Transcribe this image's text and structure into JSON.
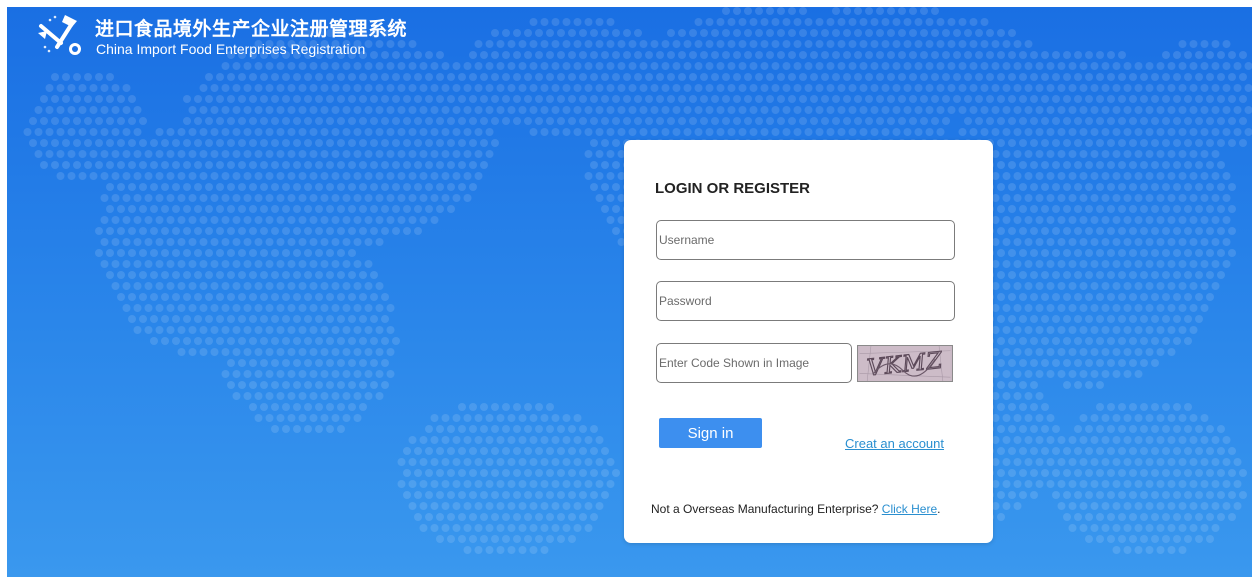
{
  "header": {
    "title_cn": "进口食品境外生产企业注册管理系统",
    "title_en": "China Import Food Enterprises Registration",
    "logo_icon": "crossed-tools-logo-icon"
  },
  "login": {
    "heading": "LOGIN OR REGISTER",
    "username": {
      "placeholder": "Username",
      "value": ""
    },
    "password": {
      "placeholder": "Password",
      "value": ""
    },
    "captcha": {
      "placeholder": "Enter Code Shown in Image",
      "value": "",
      "image_text": "VKMZ"
    },
    "signin_label": "Sign in",
    "create_account_label": "Creat an account",
    "footer_text": "Not a Overseas Manufacturing Enterprise? ",
    "footer_link_label": "Click Here",
    "footer_end": "."
  },
  "colors": {
    "background_top": "#1a6fe3",
    "background_bottom": "#3a98ee",
    "button": "#3d8fef",
    "link": "#2a8fd0"
  }
}
